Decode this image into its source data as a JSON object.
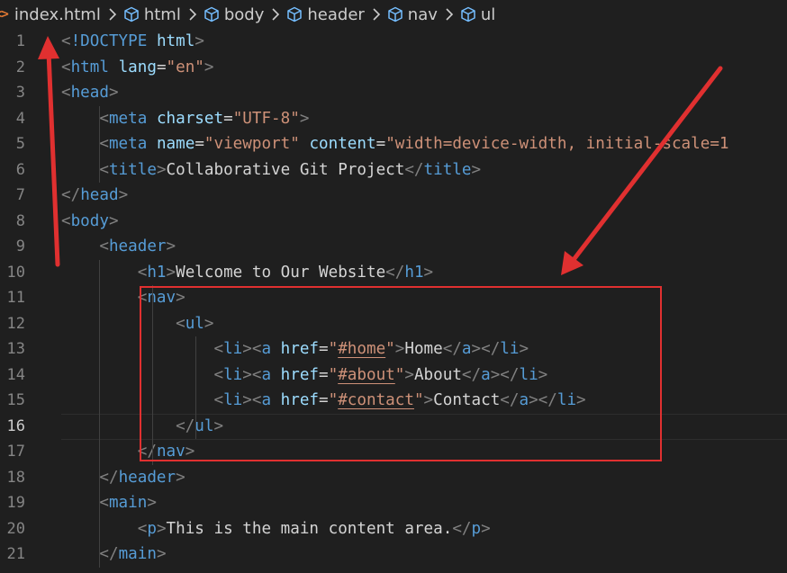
{
  "breadcrumb": {
    "file_icon": "<>",
    "file": "index.html",
    "items": [
      "html",
      "body",
      "header",
      "nav",
      "ul"
    ]
  },
  "editor": {
    "active_line": 16,
    "line_numbers": [
      "1",
      "2",
      "3",
      "4",
      "5",
      "6",
      "7",
      "8",
      "9",
      "10",
      "11",
      "12",
      "13",
      "14",
      "15",
      "16",
      "17",
      "18",
      "19",
      "20",
      "21"
    ],
    "lines": [
      [
        [
          "br",
          "<"
        ],
        [
          "tag",
          "!DOCTYPE"
        ],
        [
          "tx",
          " "
        ],
        [
          "at",
          "html"
        ],
        [
          "br",
          ">"
        ]
      ],
      [
        [
          "br",
          "<"
        ],
        [
          "tag",
          "html"
        ],
        [
          "tx",
          " "
        ],
        [
          "at",
          "lang"
        ],
        [
          "tx",
          "="
        ],
        [
          "st",
          "\"en\""
        ],
        [
          "br",
          ">"
        ]
      ],
      [
        [
          "br",
          "<"
        ],
        [
          "tag",
          "head"
        ],
        [
          "br",
          ">"
        ]
      ],
      [
        [
          "tx",
          "    "
        ],
        [
          "br",
          "<"
        ],
        [
          "tag",
          "meta"
        ],
        [
          "tx",
          " "
        ],
        [
          "at",
          "charset"
        ],
        [
          "tx",
          "="
        ],
        [
          "st",
          "\"UTF-8\""
        ],
        [
          "br",
          ">"
        ]
      ],
      [
        [
          "tx",
          "    "
        ],
        [
          "br",
          "<"
        ],
        [
          "tag",
          "meta"
        ],
        [
          "tx",
          " "
        ],
        [
          "at",
          "name"
        ],
        [
          "tx",
          "="
        ],
        [
          "st",
          "\"viewport\""
        ],
        [
          "tx",
          " "
        ],
        [
          "at",
          "content"
        ],
        [
          "tx",
          "="
        ],
        [
          "st",
          "\"width=device-width, initial-scale=1"
        ]
      ],
      [
        [
          "tx",
          "    "
        ],
        [
          "br",
          "<"
        ],
        [
          "tag",
          "title"
        ],
        [
          "br",
          ">"
        ],
        [
          "tx",
          "Collaborative Git Project"
        ],
        [
          "br",
          "</"
        ],
        [
          "tag",
          "title"
        ],
        [
          "br",
          ">"
        ]
      ],
      [
        [
          "br",
          "</"
        ],
        [
          "tag",
          "head"
        ],
        [
          "br",
          ">"
        ]
      ],
      [
        [
          "br",
          "<"
        ],
        [
          "tag",
          "body"
        ],
        [
          "br",
          ">"
        ]
      ],
      [
        [
          "tx",
          "    "
        ],
        [
          "br",
          "<"
        ],
        [
          "tag",
          "header"
        ],
        [
          "br",
          ">"
        ]
      ],
      [
        [
          "tx",
          "        "
        ],
        [
          "br",
          "<"
        ],
        [
          "tag",
          "h1"
        ],
        [
          "br",
          ">"
        ],
        [
          "tx",
          "Welcome to Our Website"
        ],
        [
          "br",
          "</"
        ],
        [
          "tag",
          "h1"
        ],
        [
          "br",
          ">"
        ]
      ],
      [
        [
          "tx",
          "        "
        ],
        [
          "br",
          "<"
        ],
        [
          "tag",
          "nav"
        ],
        [
          "br",
          ">"
        ]
      ],
      [
        [
          "tx",
          "            "
        ],
        [
          "br",
          "<"
        ],
        [
          "tag",
          "ul"
        ],
        [
          "br",
          ">"
        ]
      ],
      [
        [
          "tx",
          "                "
        ],
        [
          "br",
          "<"
        ],
        [
          "tag",
          "li"
        ],
        [
          "br",
          "><"
        ],
        [
          "tag",
          "a"
        ],
        [
          "tx",
          " "
        ],
        [
          "at",
          "href"
        ],
        [
          "tx",
          "="
        ],
        [
          "st",
          "\""
        ],
        [
          "stl",
          "#home"
        ],
        [
          "st",
          "\""
        ],
        [
          "br",
          ">"
        ],
        [
          "tx",
          "Home"
        ],
        [
          "br",
          "</"
        ],
        [
          "tag",
          "a"
        ],
        [
          "br",
          "></"
        ],
        [
          "tag",
          "li"
        ],
        [
          "br",
          ">"
        ]
      ],
      [
        [
          "tx",
          "                "
        ],
        [
          "br",
          "<"
        ],
        [
          "tag",
          "li"
        ],
        [
          "br",
          "><"
        ],
        [
          "tag",
          "a"
        ],
        [
          "tx",
          " "
        ],
        [
          "at",
          "href"
        ],
        [
          "tx",
          "="
        ],
        [
          "st",
          "\""
        ],
        [
          "stl",
          "#about"
        ],
        [
          "st",
          "\""
        ],
        [
          "br",
          ">"
        ],
        [
          "tx",
          "About"
        ],
        [
          "br",
          "</"
        ],
        [
          "tag",
          "a"
        ],
        [
          "br",
          "></"
        ],
        [
          "tag",
          "li"
        ],
        [
          "br",
          ">"
        ]
      ],
      [
        [
          "tx",
          "                "
        ],
        [
          "br",
          "<"
        ],
        [
          "tag",
          "li"
        ],
        [
          "br",
          "><"
        ],
        [
          "tag",
          "a"
        ],
        [
          "tx",
          " "
        ],
        [
          "at",
          "href"
        ],
        [
          "tx",
          "="
        ],
        [
          "st",
          "\""
        ],
        [
          "stl",
          "#contact"
        ],
        [
          "st",
          "\""
        ],
        [
          "br",
          ">"
        ],
        [
          "tx",
          "Contact"
        ],
        [
          "br",
          "</"
        ],
        [
          "tag",
          "a"
        ],
        [
          "br",
          "></"
        ],
        [
          "tag",
          "li"
        ],
        [
          "br",
          ">"
        ]
      ],
      [
        [
          "tx",
          "            "
        ],
        [
          "br",
          "</"
        ],
        [
          "tag",
          "ul"
        ],
        [
          "br",
          ">"
        ]
      ],
      [
        [
          "tx",
          "        "
        ],
        [
          "br",
          "</"
        ],
        [
          "tag",
          "nav"
        ],
        [
          "br",
          ">"
        ]
      ],
      [
        [
          "tx",
          "    "
        ],
        [
          "br",
          "</"
        ],
        [
          "tag",
          "header"
        ],
        [
          "br",
          ">"
        ]
      ],
      [
        [
          "tx",
          "    "
        ],
        [
          "br",
          "<"
        ],
        [
          "tag",
          "main"
        ],
        [
          "br",
          ">"
        ]
      ],
      [
        [
          "tx",
          "        "
        ],
        [
          "br",
          "<"
        ],
        [
          "tag",
          "p"
        ],
        [
          "br",
          ">"
        ],
        [
          "tx",
          "This is the main content area."
        ],
        [
          "br",
          "</"
        ],
        [
          "tag",
          "p"
        ],
        [
          "br",
          ">"
        ]
      ],
      [
        [
          "tx",
          "    "
        ],
        [
          "br",
          "</"
        ],
        [
          "tag",
          "main"
        ],
        [
          "br",
          ">"
        ]
      ]
    ]
  },
  "annotations": {
    "color": "#e03030"
  }
}
